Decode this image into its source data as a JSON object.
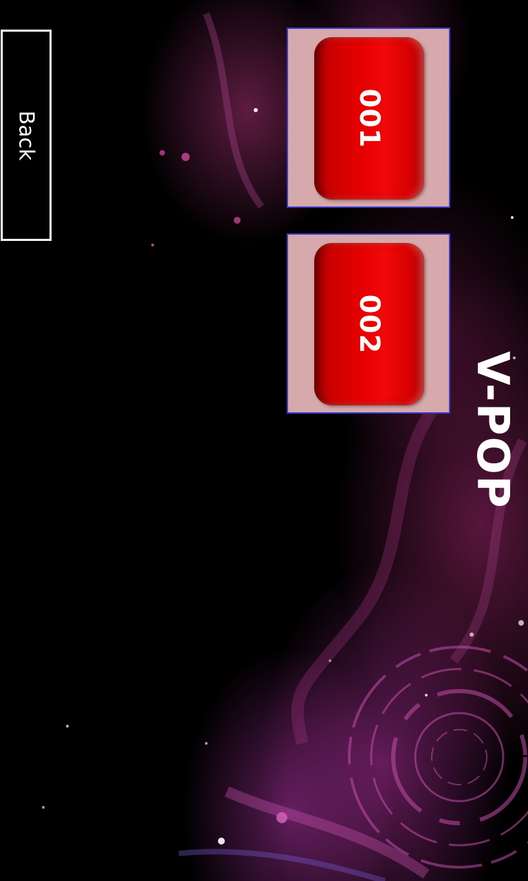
{
  "header": {
    "title": "V-POP"
  },
  "nav": {
    "back_label": "Back"
  },
  "items": [
    {
      "label": "001"
    },
    {
      "label": "002"
    }
  ],
  "colors": {
    "button_red": "#e00000",
    "tile_background": "#d6aaac",
    "tile_border": "#3a3ac8",
    "back_border": "#ffffff"
  }
}
